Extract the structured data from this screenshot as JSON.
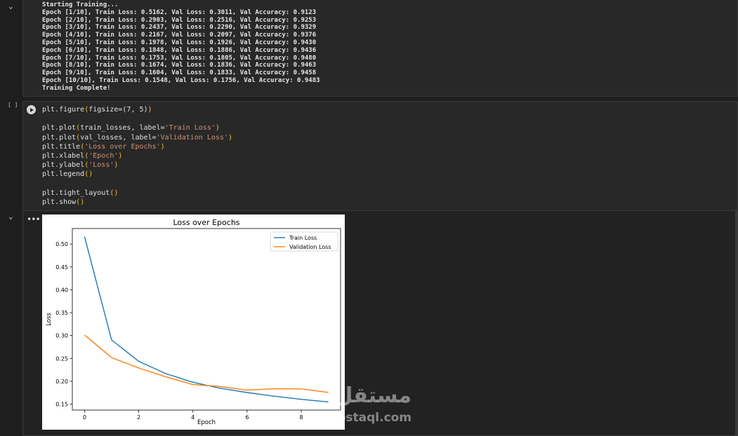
{
  "output_cell": {
    "lines": [
      "Starting Training...",
      "Epoch [1/10], Train Loss: 0.5162, Val Loss: 0.3011, Val Accuracy: 0.9123",
      "Epoch [2/10], Train Loss: 0.2903, Val Loss: 0.2516, Val Accuracy: 0.9253",
      "Epoch [3/10], Train Loss: 0.2437, Val Loss: 0.2290, Val Accuracy: 0.9329",
      "Epoch [4/10], Train Loss: 0.2167, Val Loss: 0.2097, Val Accuracy: 0.9376",
      "Epoch [5/10], Train Loss: 0.1978, Val Loss: 0.1926, Val Accuracy: 0.9430",
      "Epoch [6/10], Train Loss: 0.1848, Val Loss: 0.1886, Val Accuracy: 0.9436",
      "Epoch [7/10], Train Loss: 0.1753, Val Loss: 0.1805, Val Accuracy: 0.9480",
      "Epoch [8/10], Train Loss: 0.1674, Val Loss: 0.1836, Val Accuracy: 0.9463",
      "Epoch [9/10], Train Loss: 0.1604, Val Loss: 0.1833, Val Accuracy: 0.9458",
      "Epoch [10/10], Train Loss: 0.1548, Val Loss: 0.1756, Val Accuracy: 0.9483",
      "Training Complete!"
    ]
  },
  "code_cell": {
    "exec_label": "[ ]",
    "lines": [
      [
        {
          "t": "plt.figure"
        },
        {
          "t": "(",
          "c": "par"
        },
        {
          "t": "figsize=(7, 5)"
        },
        {
          "t": ")",
          "c": "par"
        }
      ],
      [],
      [
        {
          "t": "plt.plot"
        },
        {
          "t": "(",
          "c": "par"
        },
        {
          "t": "train_losses, label="
        },
        {
          "t": "'Train Loss'",
          "c": "str"
        },
        {
          "t": ")",
          "c": "par"
        }
      ],
      [
        {
          "t": "plt.plot"
        },
        {
          "t": "(",
          "c": "par"
        },
        {
          "t": "val_losses, label="
        },
        {
          "t": "'Validation Loss'",
          "c": "str"
        },
        {
          "t": ")",
          "c": "par"
        }
      ],
      [
        {
          "t": "plt.title"
        },
        {
          "t": "(",
          "c": "par"
        },
        {
          "t": "'Loss over Epochs'",
          "c": "str"
        },
        {
          "t": ")",
          "c": "par"
        }
      ],
      [
        {
          "t": "plt.xlabel"
        },
        {
          "t": "(",
          "c": "par"
        },
        {
          "t": "'Epoch'",
          "c": "str"
        },
        {
          "t": ")",
          "c": "par"
        }
      ],
      [
        {
          "t": "plt.ylabel"
        },
        {
          "t": "(",
          "c": "par"
        },
        {
          "t": "'Loss'",
          "c": "str"
        },
        {
          "t": ")",
          "c": "par"
        }
      ],
      [
        {
          "t": "plt.legend"
        },
        {
          "t": "()",
          "c": "par"
        }
      ],
      [],
      [
        {
          "t": "plt.tight_layout"
        },
        {
          "t": "()",
          "c": "par"
        }
      ],
      [
        {
          "t": "plt.show"
        },
        {
          "t": "()",
          "c": "par"
        }
      ]
    ]
  },
  "output_menu_label": "•••",
  "watermark": {
    "arabic": "مستقل",
    "latin": "mostaql.com"
  },
  "chart_data": {
    "type": "line",
    "title": "Loss over Epochs",
    "xlabel": "Epoch",
    "ylabel": "Loss",
    "x": [
      0,
      1,
      2,
      3,
      4,
      5,
      6,
      7,
      8,
      9
    ],
    "xticks": [
      0,
      2,
      4,
      6,
      8
    ],
    "yticks": [
      0.15,
      0.2,
      0.25,
      0.3,
      0.35,
      0.4,
      0.45,
      0.5
    ],
    "ytick_labels": [
      "0.15",
      "0.20",
      "0.25",
      "0.30",
      "0.35",
      "0.40",
      "0.45",
      "0.50"
    ],
    "xlim": [
      -0.45,
      9.45
    ],
    "ylim": [
      0.137,
      0.534
    ],
    "legend_position": "top-right",
    "series": [
      {
        "name": "Train Loss",
        "color": "#1f77b4",
        "values": [
          0.5162,
          0.2903,
          0.2437,
          0.2167,
          0.1978,
          0.1848,
          0.1753,
          0.1674,
          0.1604,
          0.1548
        ]
      },
      {
        "name": "Validation Loss",
        "color": "#ff7f0e",
        "values": [
          0.3011,
          0.2516,
          0.229,
          0.2097,
          0.1926,
          0.1886,
          0.1805,
          0.1836,
          0.1833,
          0.1756
        ]
      }
    ]
  }
}
